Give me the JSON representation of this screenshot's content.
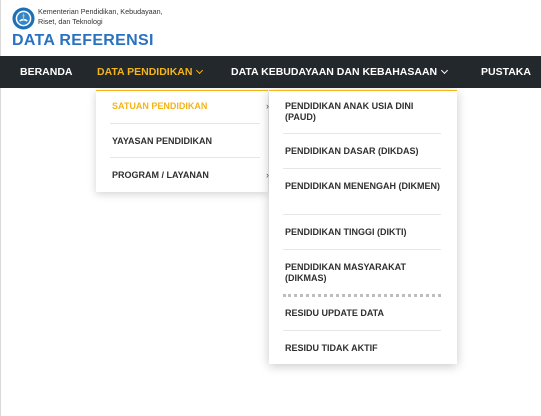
{
  "header": {
    "ministry_line1": "Kementerian Pendidikan, Kebudayaan,",
    "ministry_line2": "Riset, dan Teknologi",
    "site_title": "DATA REFERENSI",
    "logo_icon": "tut-wuri-handayani-logo"
  },
  "nav": {
    "items": [
      {
        "label": "BERANDA"
      },
      {
        "label": "DATA PENDIDIKAN"
      },
      {
        "label": "DATA KEBUDAYAAN DAN KEBAHASAAN"
      },
      {
        "label": "PUSTAKA"
      }
    ]
  },
  "dropdown": {
    "items": [
      {
        "label": "SATUAN PENDIDIKAN"
      },
      {
        "label": "YAYASAN PENDIDIKAN"
      },
      {
        "label": "PROGRAM / LAYANAN"
      }
    ],
    "arrow": "›"
  },
  "submenu": {
    "items": [
      {
        "label": "PENDIDIKAN ANAK USIA DINI (PAUD)"
      },
      {
        "label": "PENDIDIKAN DASAR (DIKDAS)"
      },
      {
        "label": "PENDIDIKAN MENENGAH (DIKMEN)"
      },
      {
        "label": "PENDIDIKAN TINGGI (DIKTI)"
      },
      {
        "label": "PENDIDIKAN MASYARAKAT (DIKMAS)"
      },
      {
        "label": "RESIDU UPDATE DATA"
      },
      {
        "label": "RESIDU TIDAK AKTIF"
      }
    ]
  },
  "colors": {
    "accent": "#f4b41a",
    "navbar": "#23282d",
    "title_blue": "#2a72c0"
  }
}
